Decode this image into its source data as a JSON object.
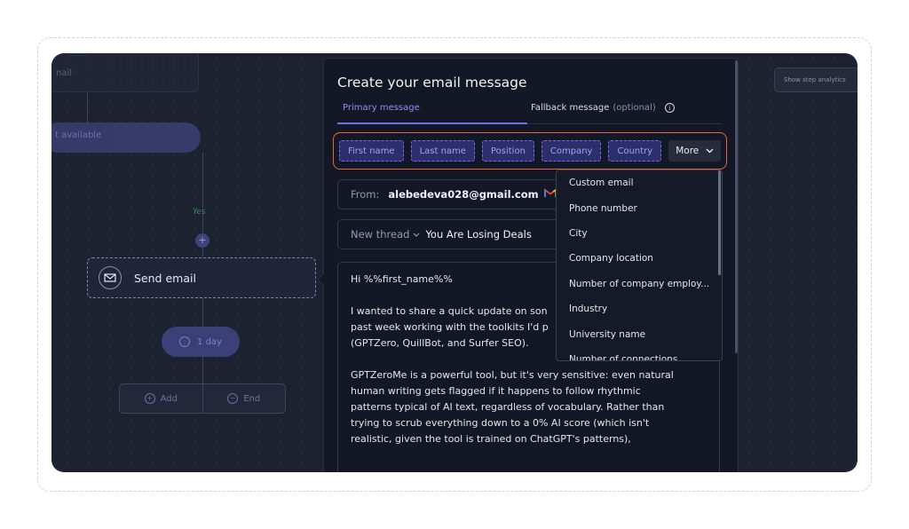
{
  "flow": {
    "top_node_label": "nail",
    "available_label": "t available",
    "yes_label": "Yes",
    "plus": "+",
    "send_email_label": "Send email",
    "delay_label": "1 day",
    "add_label": "Add",
    "end_label": "End",
    "show_analytics": "Show step analytics"
  },
  "panel": {
    "title": "Create your email message",
    "tabs": {
      "primary": "Primary message",
      "fallback": "Fallback message",
      "fallback_optional": "(optional)"
    },
    "tags": [
      "First name",
      "Last name",
      "Position",
      "Company",
      "Country"
    ],
    "more_label": "More",
    "from": {
      "label": "From:",
      "email": "alebedeva028@gmail.com",
      "provider_icon": "gmail-icon"
    },
    "thread": {
      "mode": "New thread",
      "subject": "You Are Losing Deals"
    },
    "body": {
      "greeting": "Hi %%first_name%%",
      "para1_l1": "I wanted to share a quick update on son",
      "para1_l2": "past week working with the toolkits I'd p",
      "para1_l3": "(GPTZero, QuillBot, and Surfer SEO).",
      "para2_l1": "GPTZeroMe is a powerful tool, but it's very sensitive: even natural",
      "para2_l2": "human writing gets flagged if it happens to follow rhythmic",
      "para2_l3": "patterns typical of AI text, regardless of vocabulary. Rather than",
      "para2_l4": "trying to scrub everything down to a 0% AI score (which isn't",
      "para2_l5": "realistic, given the tool is trained on ChatGPT's patterns),"
    }
  },
  "dropdown": {
    "items": [
      "Custom email",
      "Phone number",
      "City",
      "Company location",
      "Number of company employ...",
      "Industry",
      "University name",
      "Number of connections"
    ]
  },
  "colors": {
    "accent": "#6e72e8",
    "highlight_border": "#e0683c",
    "canvas_bg": "#1d2231",
    "panel_bg": "#141826"
  }
}
